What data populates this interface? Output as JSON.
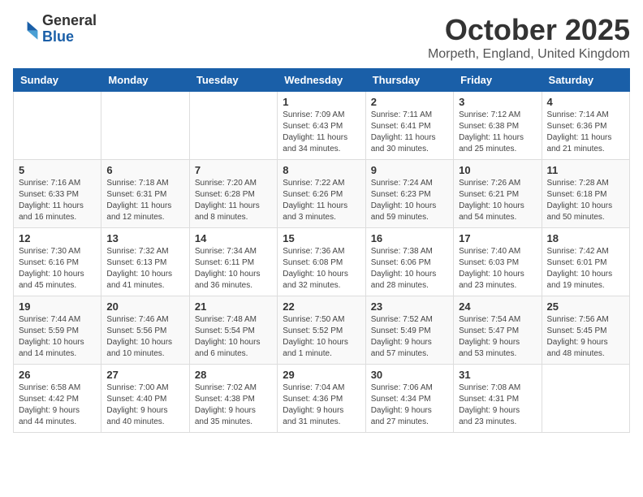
{
  "logo": {
    "general": "General",
    "blue": "Blue"
  },
  "header": {
    "month": "October 2025",
    "location": "Morpeth, England, United Kingdom"
  },
  "days_of_week": [
    "Sunday",
    "Monday",
    "Tuesday",
    "Wednesday",
    "Thursday",
    "Friday",
    "Saturday"
  ],
  "weeks": [
    [
      {
        "day": "",
        "info": ""
      },
      {
        "day": "",
        "info": ""
      },
      {
        "day": "",
        "info": ""
      },
      {
        "day": "1",
        "info": "Sunrise: 7:09 AM\nSunset: 6:43 PM\nDaylight: 11 hours\nand 34 minutes."
      },
      {
        "day": "2",
        "info": "Sunrise: 7:11 AM\nSunset: 6:41 PM\nDaylight: 11 hours\nand 30 minutes."
      },
      {
        "day": "3",
        "info": "Sunrise: 7:12 AM\nSunset: 6:38 PM\nDaylight: 11 hours\nand 25 minutes."
      },
      {
        "day": "4",
        "info": "Sunrise: 7:14 AM\nSunset: 6:36 PM\nDaylight: 11 hours\nand 21 minutes."
      }
    ],
    [
      {
        "day": "5",
        "info": "Sunrise: 7:16 AM\nSunset: 6:33 PM\nDaylight: 11 hours\nand 16 minutes."
      },
      {
        "day": "6",
        "info": "Sunrise: 7:18 AM\nSunset: 6:31 PM\nDaylight: 11 hours\nand 12 minutes."
      },
      {
        "day": "7",
        "info": "Sunrise: 7:20 AM\nSunset: 6:28 PM\nDaylight: 11 hours\nand 8 minutes."
      },
      {
        "day": "8",
        "info": "Sunrise: 7:22 AM\nSunset: 6:26 PM\nDaylight: 11 hours\nand 3 minutes."
      },
      {
        "day": "9",
        "info": "Sunrise: 7:24 AM\nSunset: 6:23 PM\nDaylight: 10 hours\nand 59 minutes."
      },
      {
        "day": "10",
        "info": "Sunrise: 7:26 AM\nSunset: 6:21 PM\nDaylight: 10 hours\nand 54 minutes."
      },
      {
        "day": "11",
        "info": "Sunrise: 7:28 AM\nSunset: 6:18 PM\nDaylight: 10 hours\nand 50 minutes."
      }
    ],
    [
      {
        "day": "12",
        "info": "Sunrise: 7:30 AM\nSunset: 6:16 PM\nDaylight: 10 hours\nand 45 minutes."
      },
      {
        "day": "13",
        "info": "Sunrise: 7:32 AM\nSunset: 6:13 PM\nDaylight: 10 hours\nand 41 minutes."
      },
      {
        "day": "14",
        "info": "Sunrise: 7:34 AM\nSunset: 6:11 PM\nDaylight: 10 hours\nand 36 minutes."
      },
      {
        "day": "15",
        "info": "Sunrise: 7:36 AM\nSunset: 6:08 PM\nDaylight: 10 hours\nand 32 minutes."
      },
      {
        "day": "16",
        "info": "Sunrise: 7:38 AM\nSunset: 6:06 PM\nDaylight: 10 hours\nand 28 minutes."
      },
      {
        "day": "17",
        "info": "Sunrise: 7:40 AM\nSunset: 6:03 PM\nDaylight: 10 hours\nand 23 minutes."
      },
      {
        "day": "18",
        "info": "Sunrise: 7:42 AM\nSunset: 6:01 PM\nDaylight: 10 hours\nand 19 minutes."
      }
    ],
    [
      {
        "day": "19",
        "info": "Sunrise: 7:44 AM\nSunset: 5:59 PM\nDaylight: 10 hours\nand 14 minutes."
      },
      {
        "day": "20",
        "info": "Sunrise: 7:46 AM\nSunset: 5:56 PM\nDaylight: 10 hours\nand 10 minutes."
      },
      {
        "day": "21",
        "info": "Sunrise: 7:48 AM\nSunset: 5:54 PM\nDaylight: 10 hours\nand 6 minutes."
      },
      {
        "day": "22",
        "info": "Sunrise: 7:50 AM\nSunset: 5:52 PM\nDaylight: 10 hours\nand 1 minute."
      },
      {
        "day": "23",
        "info": "Sunrise: 7:52 AM\nSunset: 5:49 PM\nDaylight: 9 hours\nand 57 minutes."
      },
      {
        "day": "24",
        "info": "Sunrise: 7:54 AM\nSunset: 5:47 PM\nDaylight: 9 hours\nand 53 minutes."
      },
      {
        "day": "25",
        "info": "Sunrise: 7:56 AM\nSunset: 5:45 PM\nDaylight: 9 hours\nand 48 minutes."
      }
    ],
    [
      {
        "day": "26",
        "info": "Sunrise: 6:58 AM\nSunset: 4:42 PM\nDaylight: 9 hours\nand 44 minutes."
      },
      {
        "day": "27",
        "info": "Sunrise: 7:00 AM\nSunset: 4:40 PM\nDaylight: 9 hours\nand 40 minutes."
      },
      {
        "day": "28",
        "info": "Sunrise: 7:02 AM\nSunset: 4:38 PM\nDaylight: 9 hours\nand 35 minutes."
      },
      {
        "day": "29",
        "info": "Sunrise: 7:04 AM\nSunset: 4:36 PM\nDaylight: 9 hours\nand 31 minutes."
      },
      {
        "day": "30",
        "info": "Sunrise: 7:06 AM\nSunset: 4:34 PM\nDaylight: 9 hours\nand 27 minutes."
      },
      {
        "day": "31",
        "info": "Sunrise: 7:08 AM\nSunset: 4:31 PM\nDaylight: 9 hours\nand 23 minutes."
      },
      {
        "day": "",
        "info": ""
      }
    ]
  ]
}
